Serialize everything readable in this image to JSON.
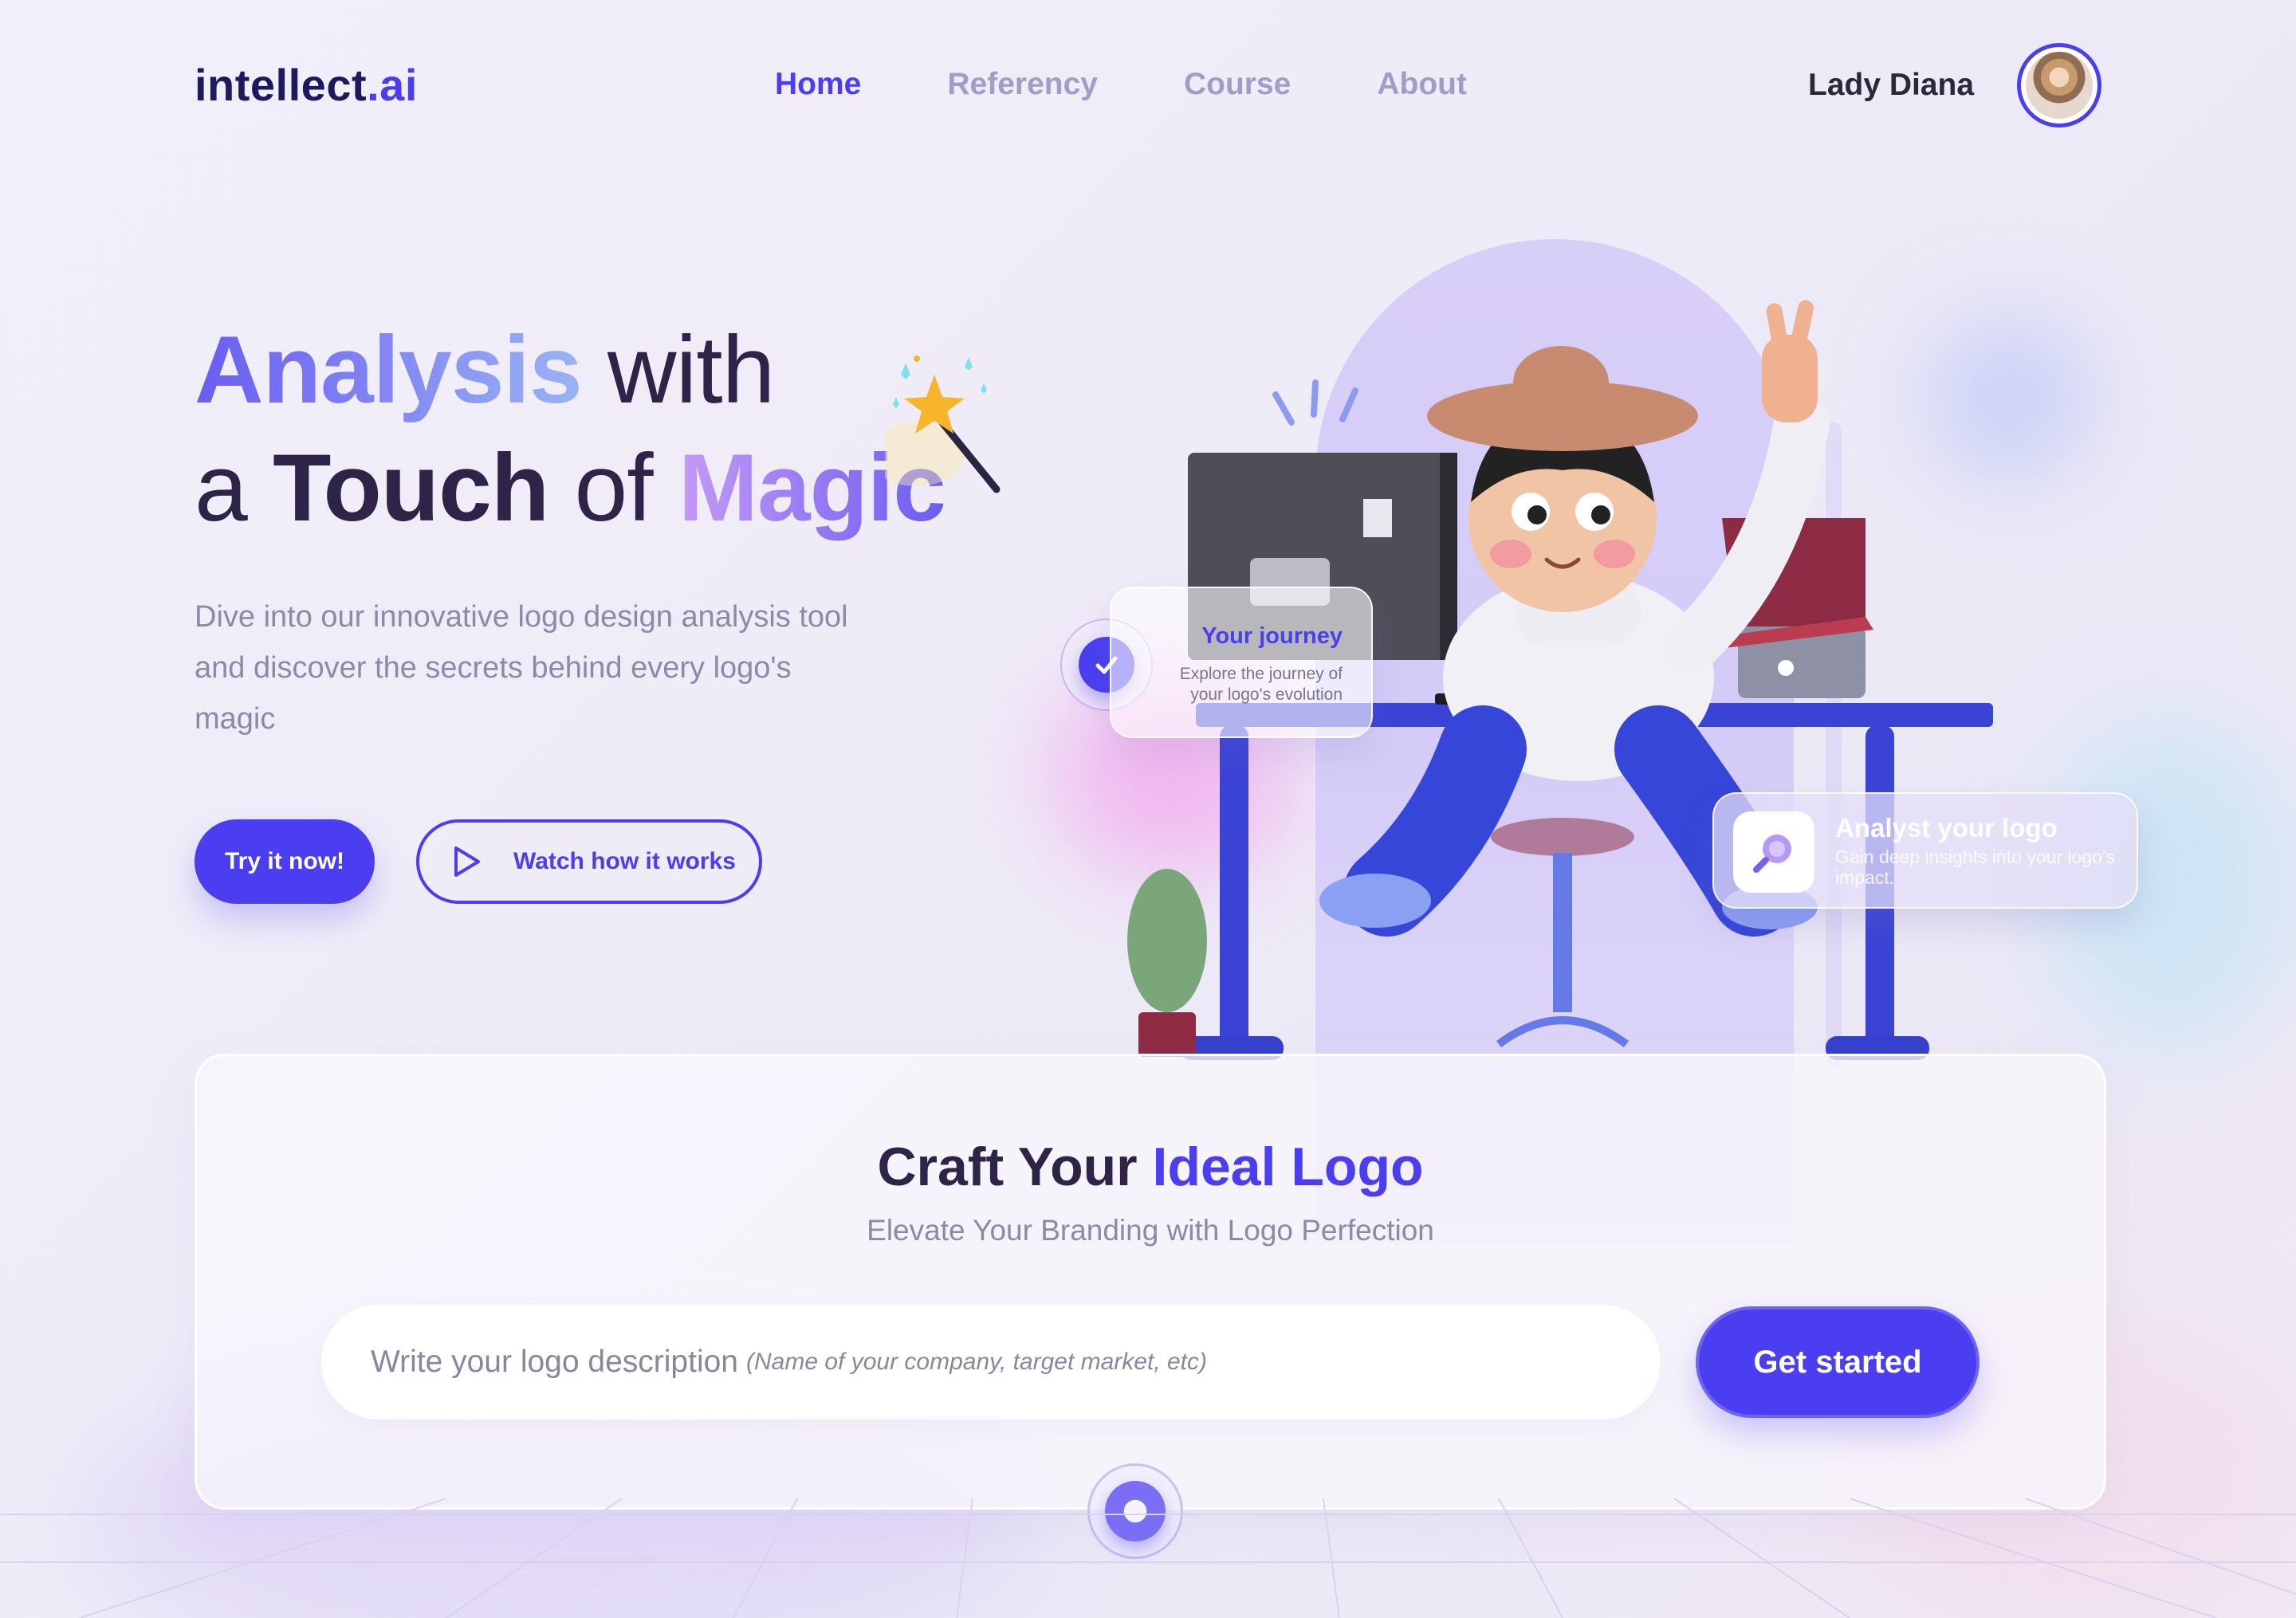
{
  "brand": {
    "name": "intellect",
    "suffix": ".ai"
  },
  "nav": {
    "items": [
      {
        "label": "Home",
        "active": true
      },
      {
        "label": "Referency",
        "active": false
      },
      {
        "label": "Course",
        "active": false
      },
      {
        "label": "About",
        "active": false
      }
    ]
  },
  "user": {
    "name": "Lady Diana",
    "avatar_icon": "avatar-photo"
  },
  "hero": {
    "title_part1": "Analysis",
    "title_part2": " with",
    "title_part3": "a ",
    "title_part4": "Touch",
    "title_part5": " of ",
    "title_part6": "Magic",
    "description": "Dive into our innovative logo design analysis tool and discover the secrets behind every logo's magic",
    "primary_button": "Try it now!",
    "secondary_button": "Watch how it works"
  },
  "cards": {
    "journey": {
      "title": "Your journey",
      "subtitle": "Explore the journey of your logo's evolution"
    },
    "analyst": {
      "title": "Analyst your logo",
      "subtitle": "Gain deep insights into your logo's impact."
    }
  },
  "craft": {
    "title_part1": "Craft Your ",
    "title_part2": "Ideal Logo",
    "subtitle": "Elevate Your Branding with Logo Perfection",
    "input_placeholder_main": "Write your logo description",
    "input_placeholder_hint": "(Name of your company, target market, etc)",
    "button": "Get started"
  },
  "colors": {
    "accent": "#4a3ef0",
    "text_dark": "#2d2448",
    "muted": "#8e89a6"
  }
}
